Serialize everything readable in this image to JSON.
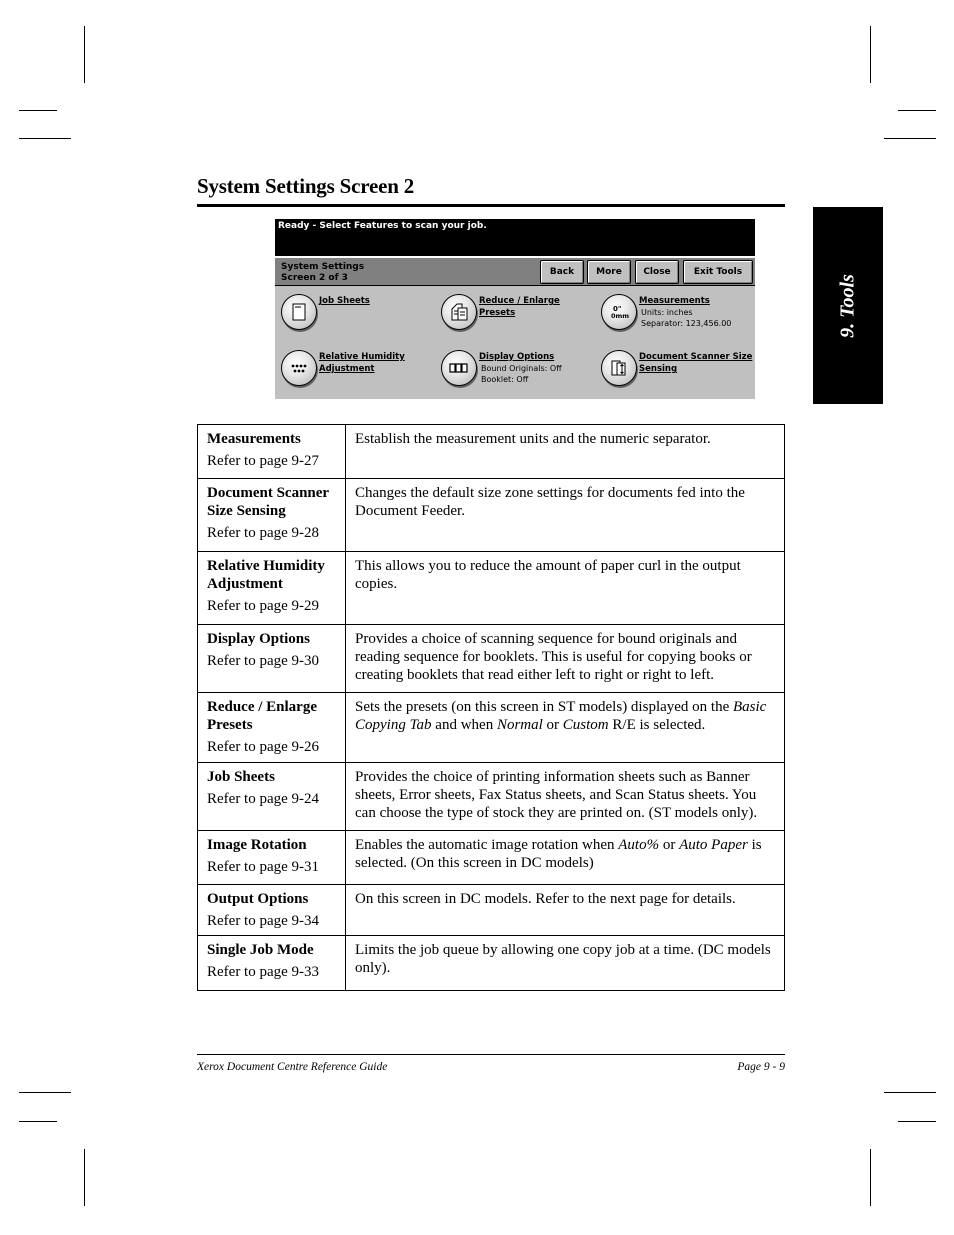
{
  "section_title": "System Settings Screen 2",
  "side_tab": "9. Tools",
  "device_screen": {
    "message": "Ready -  Select Features to scan your job.",
    "nav_title": [
      "System Settings",
      "Screen 2 of 3"
    ],
    "buttons": [
      "Back",
      "More",
      "Close",
      "Exit Tools"
    ],
    "features": [
      {
        "label": [
          "Job Sheets"
        ],
        "sub": [],
        "icon": "document-icon"
      },
      {
        "label": [
          "Reduce / Enlarge",
          "Presets"
        ],
        "sub": [],
        "icon": "reduce-enlarge-icon"
      },
      {
        "label": [
          "Measurements"
        ],
        "sub": [
          "Units: inches",
          "Separator: 123,456.00"
        ],
        "icon": "measurements-icon"
      },
      {
        "label": [
          "Relative Humidity",
          "Adjustment"
        ],
        "sub": [],
        "icon": "humidity-icon"
      },
      {
        "label": [
          "Display Options"
        ],
        "sub": [
          "Bound Originals: Off",
          "Booklet: Off"
        ],
        "icon": "display-options-icon"
      },
      {
        "label": [
          "Document Scanner Size",
          "Sensing"
        ],
        "sub": [],
        "icon": "scanner-size-icon"
      }
    ]
  },
  "table": [
    {
      "name": "Measurements",
      "ref": "Refer to page 9-27",
      "desc": "Establish the measurement units and the numeric separator."
    },
    {
      "name": "Document Scanner Size Sensing",
      "ref": "Refer to page 9-28",
      "desc": "Changes the default size zone settings for documents fed into the Document Feeder."
    },
    {
      "name": "Relative Humidity Adjustment",
      "ref": "Refer to page 9-29",
      "desc": "This allows you to reduce the amount of paper curl in the output copies."
    },
    {
      "name": "Display Options",
      "ref": "Refer to page 9-30",
      "desc": "Provides a choice of scanning sequence for bound originals and reading sequence for booklets. This is useful for copying books or creating booklets that read either left to right or right to left."
    },
    {
      "name": "Reduce / Enlarge Presets",
      "ref": "Refer to page 9-26",
      "desc_parts": [
        "Sets the presets (on this screen in ST models) displayed on the ",
        "Basic Copying Tab",
        " and when ",
        "Normal",
        " or ",
        "Custom",
        " R/E is selected."
      ]
    },
    {
      "name": "Job Sheets",
      "ref": "Refer to page 9-24",
      "desc": "Provides the choice of printing information sheets such as Banner sheets, Error sheets, Fax Status sheets, and Scan Status sheets. You can choose the type of stock they are printed on. (ST models only)."
    },
    {
      "name": "Image Rotation",
      "ref": "Refer to page 9-31",
      "desc_parts": [
        "Enables the automatic image rotation when ",
        "Auto%",
        " or ",
        "Auto Paper",
        " is selected. (On this screen in DC models)"
      ]
    },
    {
      "name": "Output Options",
      "ref": "Refer to page 9-34",
      "desc": "On this screen in DC models. Refer to the next page for details."
    },
    {
      "name": "Single Job Mode",
      "ref": "Refer to page 9-33",
      "desc": "Limits the job queue by allowing one copy job at a time. (DC models only)."
    }
  ],
  "footer": {
    "left": "Xerox Document Centre Reference Guide",
    "right": "Page 9 - 9"
  }
}
